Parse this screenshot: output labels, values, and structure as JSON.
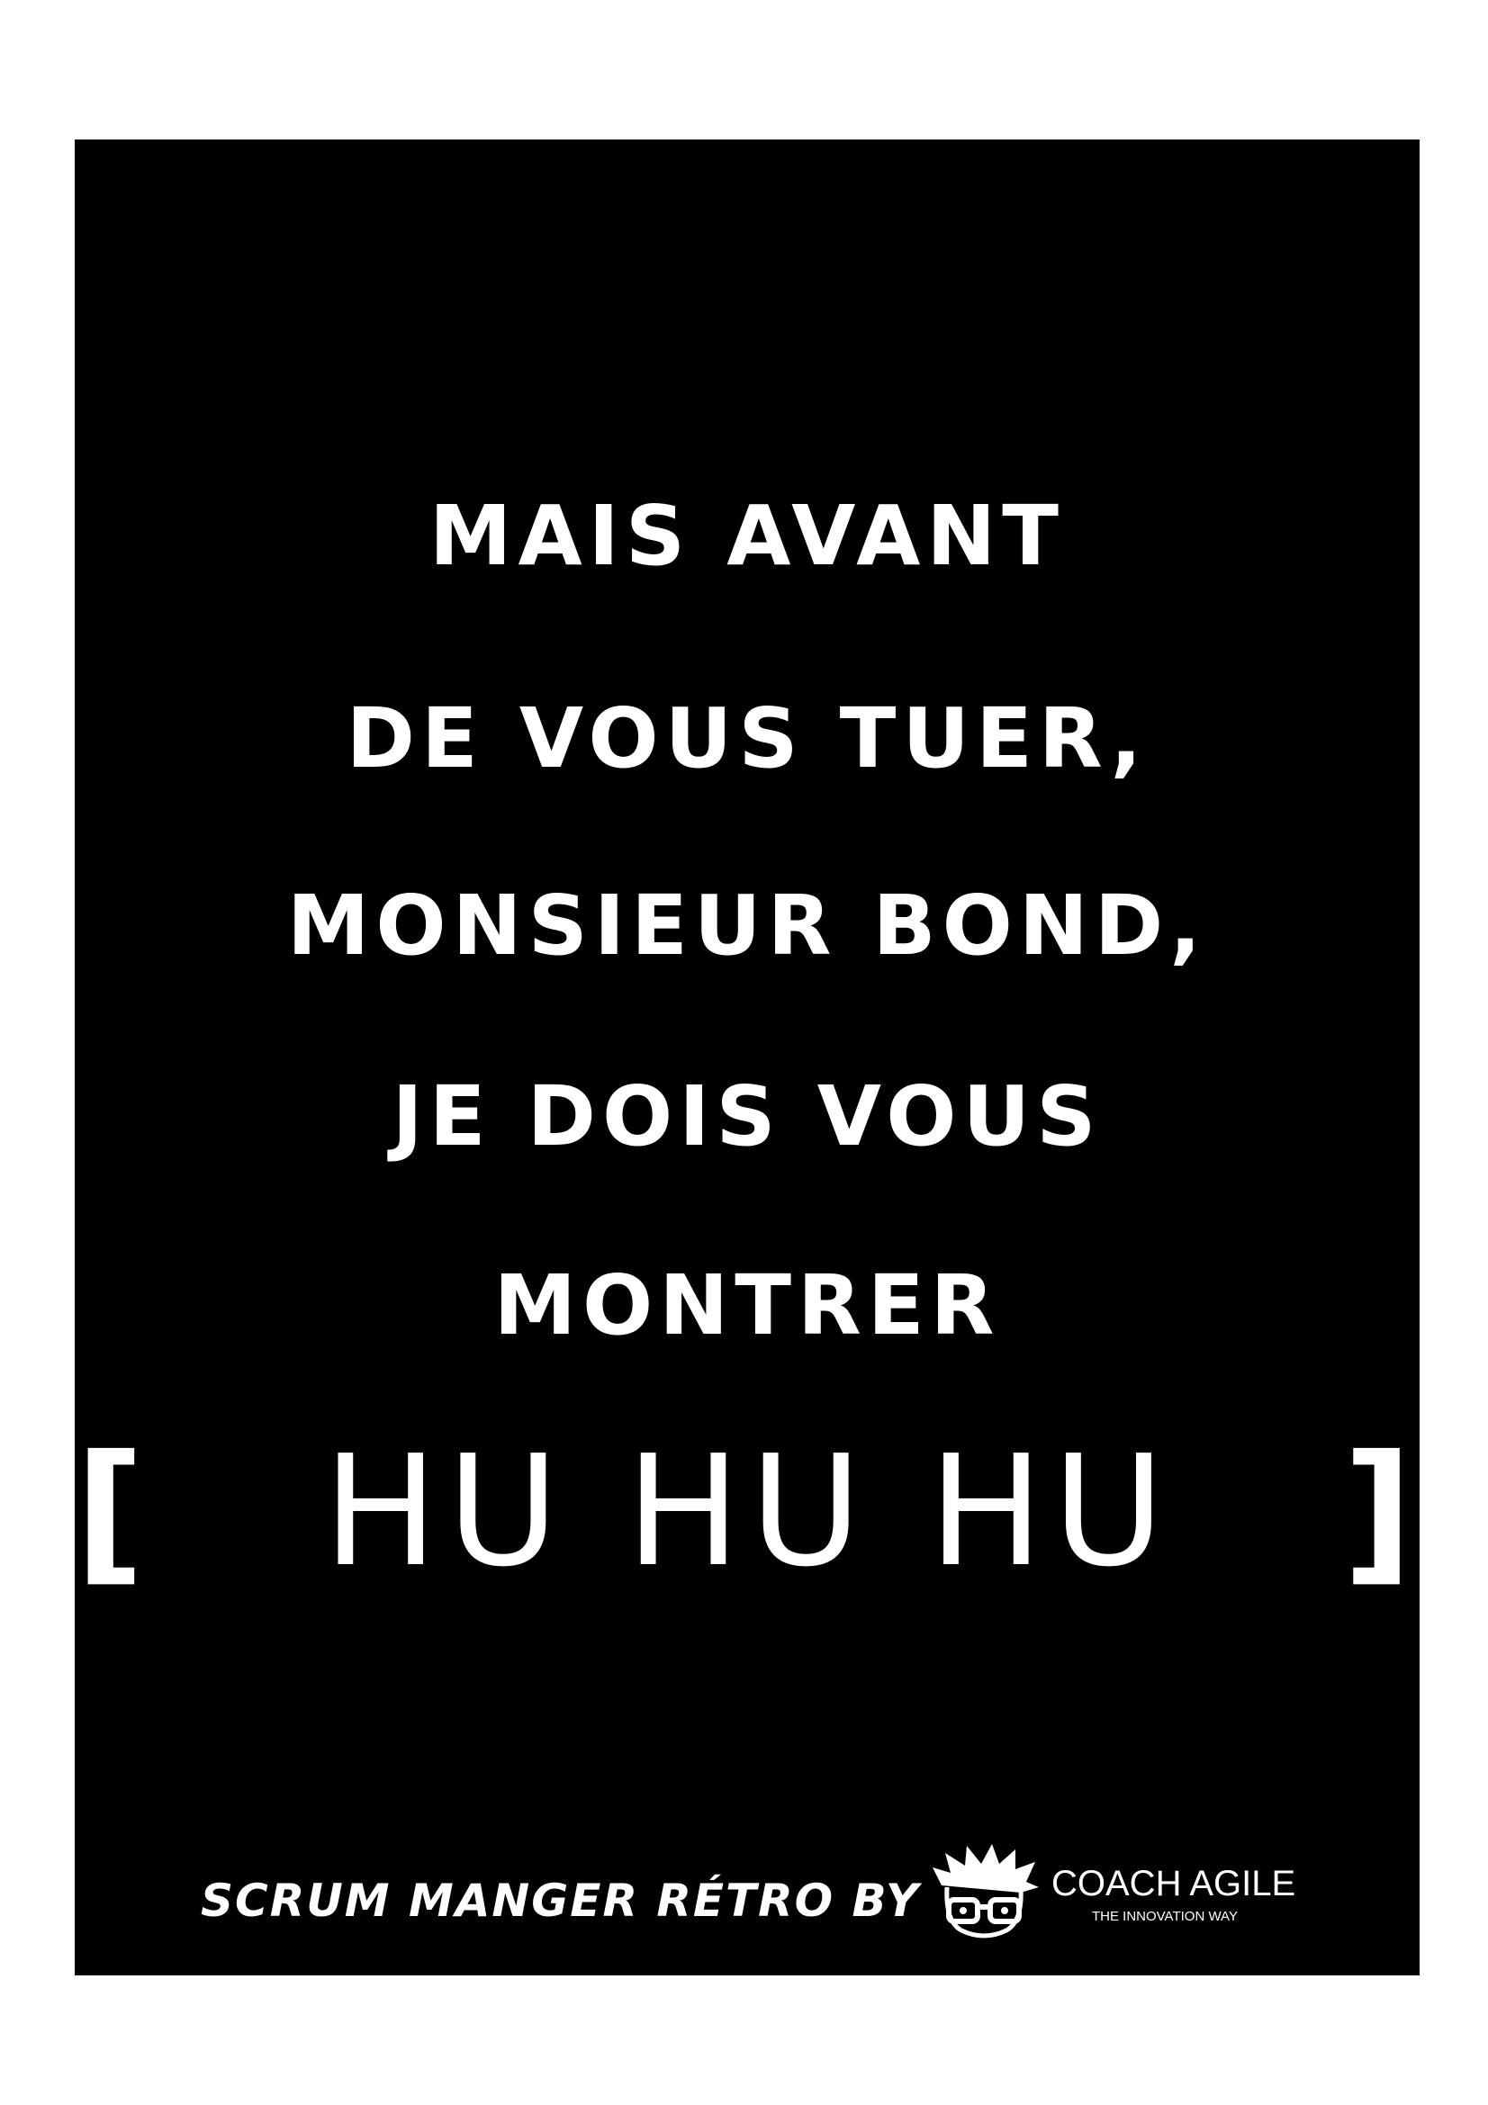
{
  "quote": {
    "lines": [
      "MAIS AVANT",
      "DE VOUS TUER,",
      "MONSIEUR BOND,",
      "JE DOIS VOUS",
      "MONTRER"
    ],
    "bracket_open": "[",
    "bracket_text": "HU HU HU",
    "bracket_close": "]"
  },
  "footer": {
    "text": "SCRUM MANGER RÉTRO BY",
    "brand_name": "COACH AGILE",
    "brand_tagline": "THE INNOVATION WAY",
    "logo_icon": "cartoon-face-with-glasses-icon"
  },
  "colors": {
    "background": "#000000",
    "text": "#ffffff",
    "page": "#ffffff"
  }
}
